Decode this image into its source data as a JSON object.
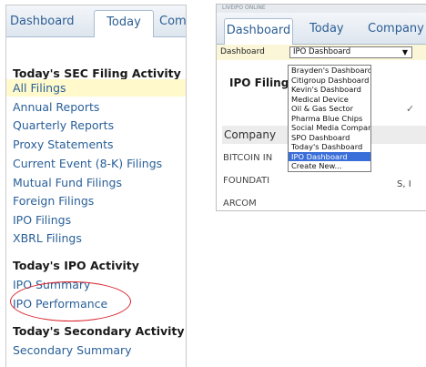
{
  "left_panel": {
    "tabs": [
      "Dashboard",
      "Today",
      "Com"
    ],
    "sections": [
      {
        "title": "Today's SEC Filing Activity",
        "links": [
          "All Filings",
          "Annual Reports",
          "Quarterly Reports",
          "Proxy Statements",
          "Current Event (8-K) Filings",
          "Mutual Fund Filings",
          "Foreign Filings",
          "IPO Filings",
          "XBRL Filings"
        ]
      },
      {
        "title": "Today's IPO Activity",
        "links": [
          "IPO Summary",
          "IPO Performance"
        ]
      },
      {
        "title": "Today's Secondary Activity",
        "links": [
          "Secondary Summary"
        ]
      }
    ],
    "colors": {
      "link": "#2a6099",
      "selected_bg": "#fff9cc",
      "highlight_ellipse": "#d8212a"
    }
  },
  "right_panel": {
    "top_strip": "LIVEIPO ONLINE",
    "tabs": [
      "Dashboard",
      "Today",
      "Company"
    ],
    "dashboard_label": "Dashboard",
    "dashboard_select_value": "IPO Dashboard",
    "dropdown_arrow": "▼",
    "section_title": "IPO Filing",
    "check_glyph": "✓",
    "company_header": "Company",
    "rows": [
      "BITCOIN IN",
      "FOUNDATI",
      "ARCOM"
    ],
    "row_tail": "S, I",
    "dropdown_options": [
      "Brayden's Dashboard",
      "Citigroup Dashboard",
      "Kevin's Dashboard",
      "Medical Device",
      "Oil & Gas Sector",
      "Pharma Blue Chips",
      "Social Media Companies",
      "SPO Dashboard",
      "Today's Dashboard",
      "IPO Dashboard",
      "Create New..."
    ],
    "dropdown_selected": "IPO Dashboard",
    "colors": {
      "selected_option_bg": "#3a6ed8",
      "dashboard_row_bg": "#fbf6d8"
    }
  }
}
